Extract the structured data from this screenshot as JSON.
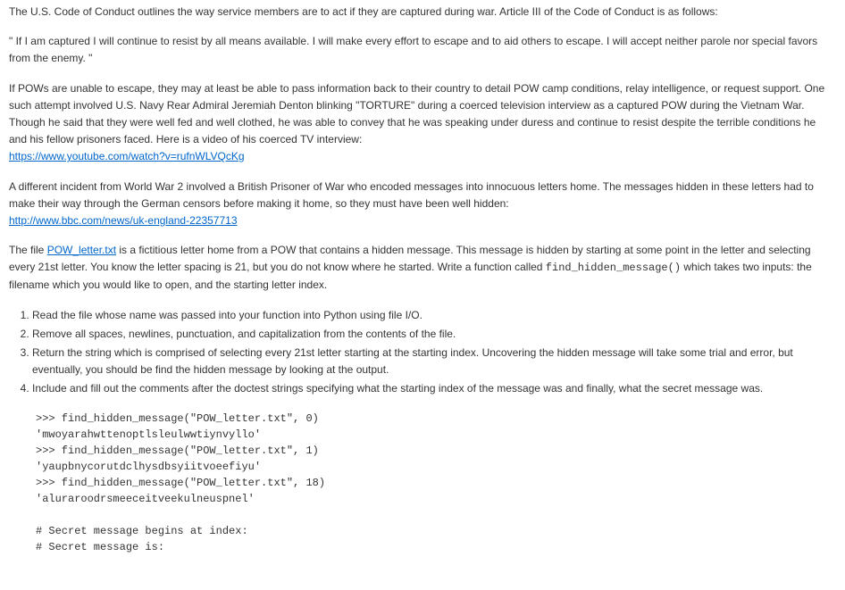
{
  "para_intro": "The U.S. Code of Conduct outlines the way service members are to act if they are captured during war. Article III of the Code of Conduct is as follows:",
  "quote": "\" If I am captured I will continue to resist by all means available. I will make every effort to escape and to aid others to escape. I will accept neither parole nor special favors from the enemy. \"",
  "para_pow": "If POWs are unable to escape, they may at least be able to pass information back to their country to detail POW camp conditions, relay intelligence, or request support. One such attempt involved U.S. Navy Rear Admiral Jeremiah Denton blinking \"TORTURE\" during a coerced television interview as a captured POW during the Vietnam War. Though he said that they were well fed and well clothed, he was able to convey that he was speaking under duress and continue to resist despite the terrible conditions he and his fellow prisoners faced. Here is a video of his coerced TV interview:",
  "link_youtube": "https://www.youtube.com/watch?v=rufnWLVQcKg",
  "para_ww2": "A different incident from World War 2 involved a British Prisoner of War who encoded messages into innocuous letters home. The messages hidden in these letters had to make their way through the German censors before making it home, so they must have been well hidden:",
  "link_bbc": "http://www.bbc.com/news/uk-england-22357713",
  "para_file_pre": "The file ",
  "file_link": "POW_letter.txt",
  "para_file_mid": " is a fictitious letter home from a POW that contains a hidden message. This message is hidden by starting at some point in the letter and selecting every 21st letter. You know the letter spacing is 21, but you do not know where he started. Write a function called ",
  "func_name": "find_hidden_message()",
  "para_file_post": " which takes two inputs: the filename which you would like to open, and the starting letter index.",
  "steps": [
    "Read the file whose name was passed into your function into Python using file I/O.",
    "Remove all spaces, newlines, punctuation, and capitalization from the contents of the file.",
    "Return the string which is comprised of selecting every 21st letter starting at the starting index. Uncovering the hidden message will take some trial and error, but eventually, you should be find the hidden message by looking at the output.",
    "Include and fill out the comments after the doctest strings specifying what the starting index of the message was and finally, what the secret message was."
  ],
  "code_block": ">>> find_hidden_message(\"POW_letter.txt\", 0)\n'mwoyarahwttenoptlsleulwwtiynvyllo'\n>>> find_hidden_message(\"POW_letter.txt\", 1)\n'yaupbnycorutdclhysdbsyiitvoeefiyu'\n>>> find_hidden_message(\"POW_letter.txt\", 18)\n'aluraroodrsmeeceitveekulneuspnel'\n\n# Secret message begins at index:\n# Secret message is:"
}
